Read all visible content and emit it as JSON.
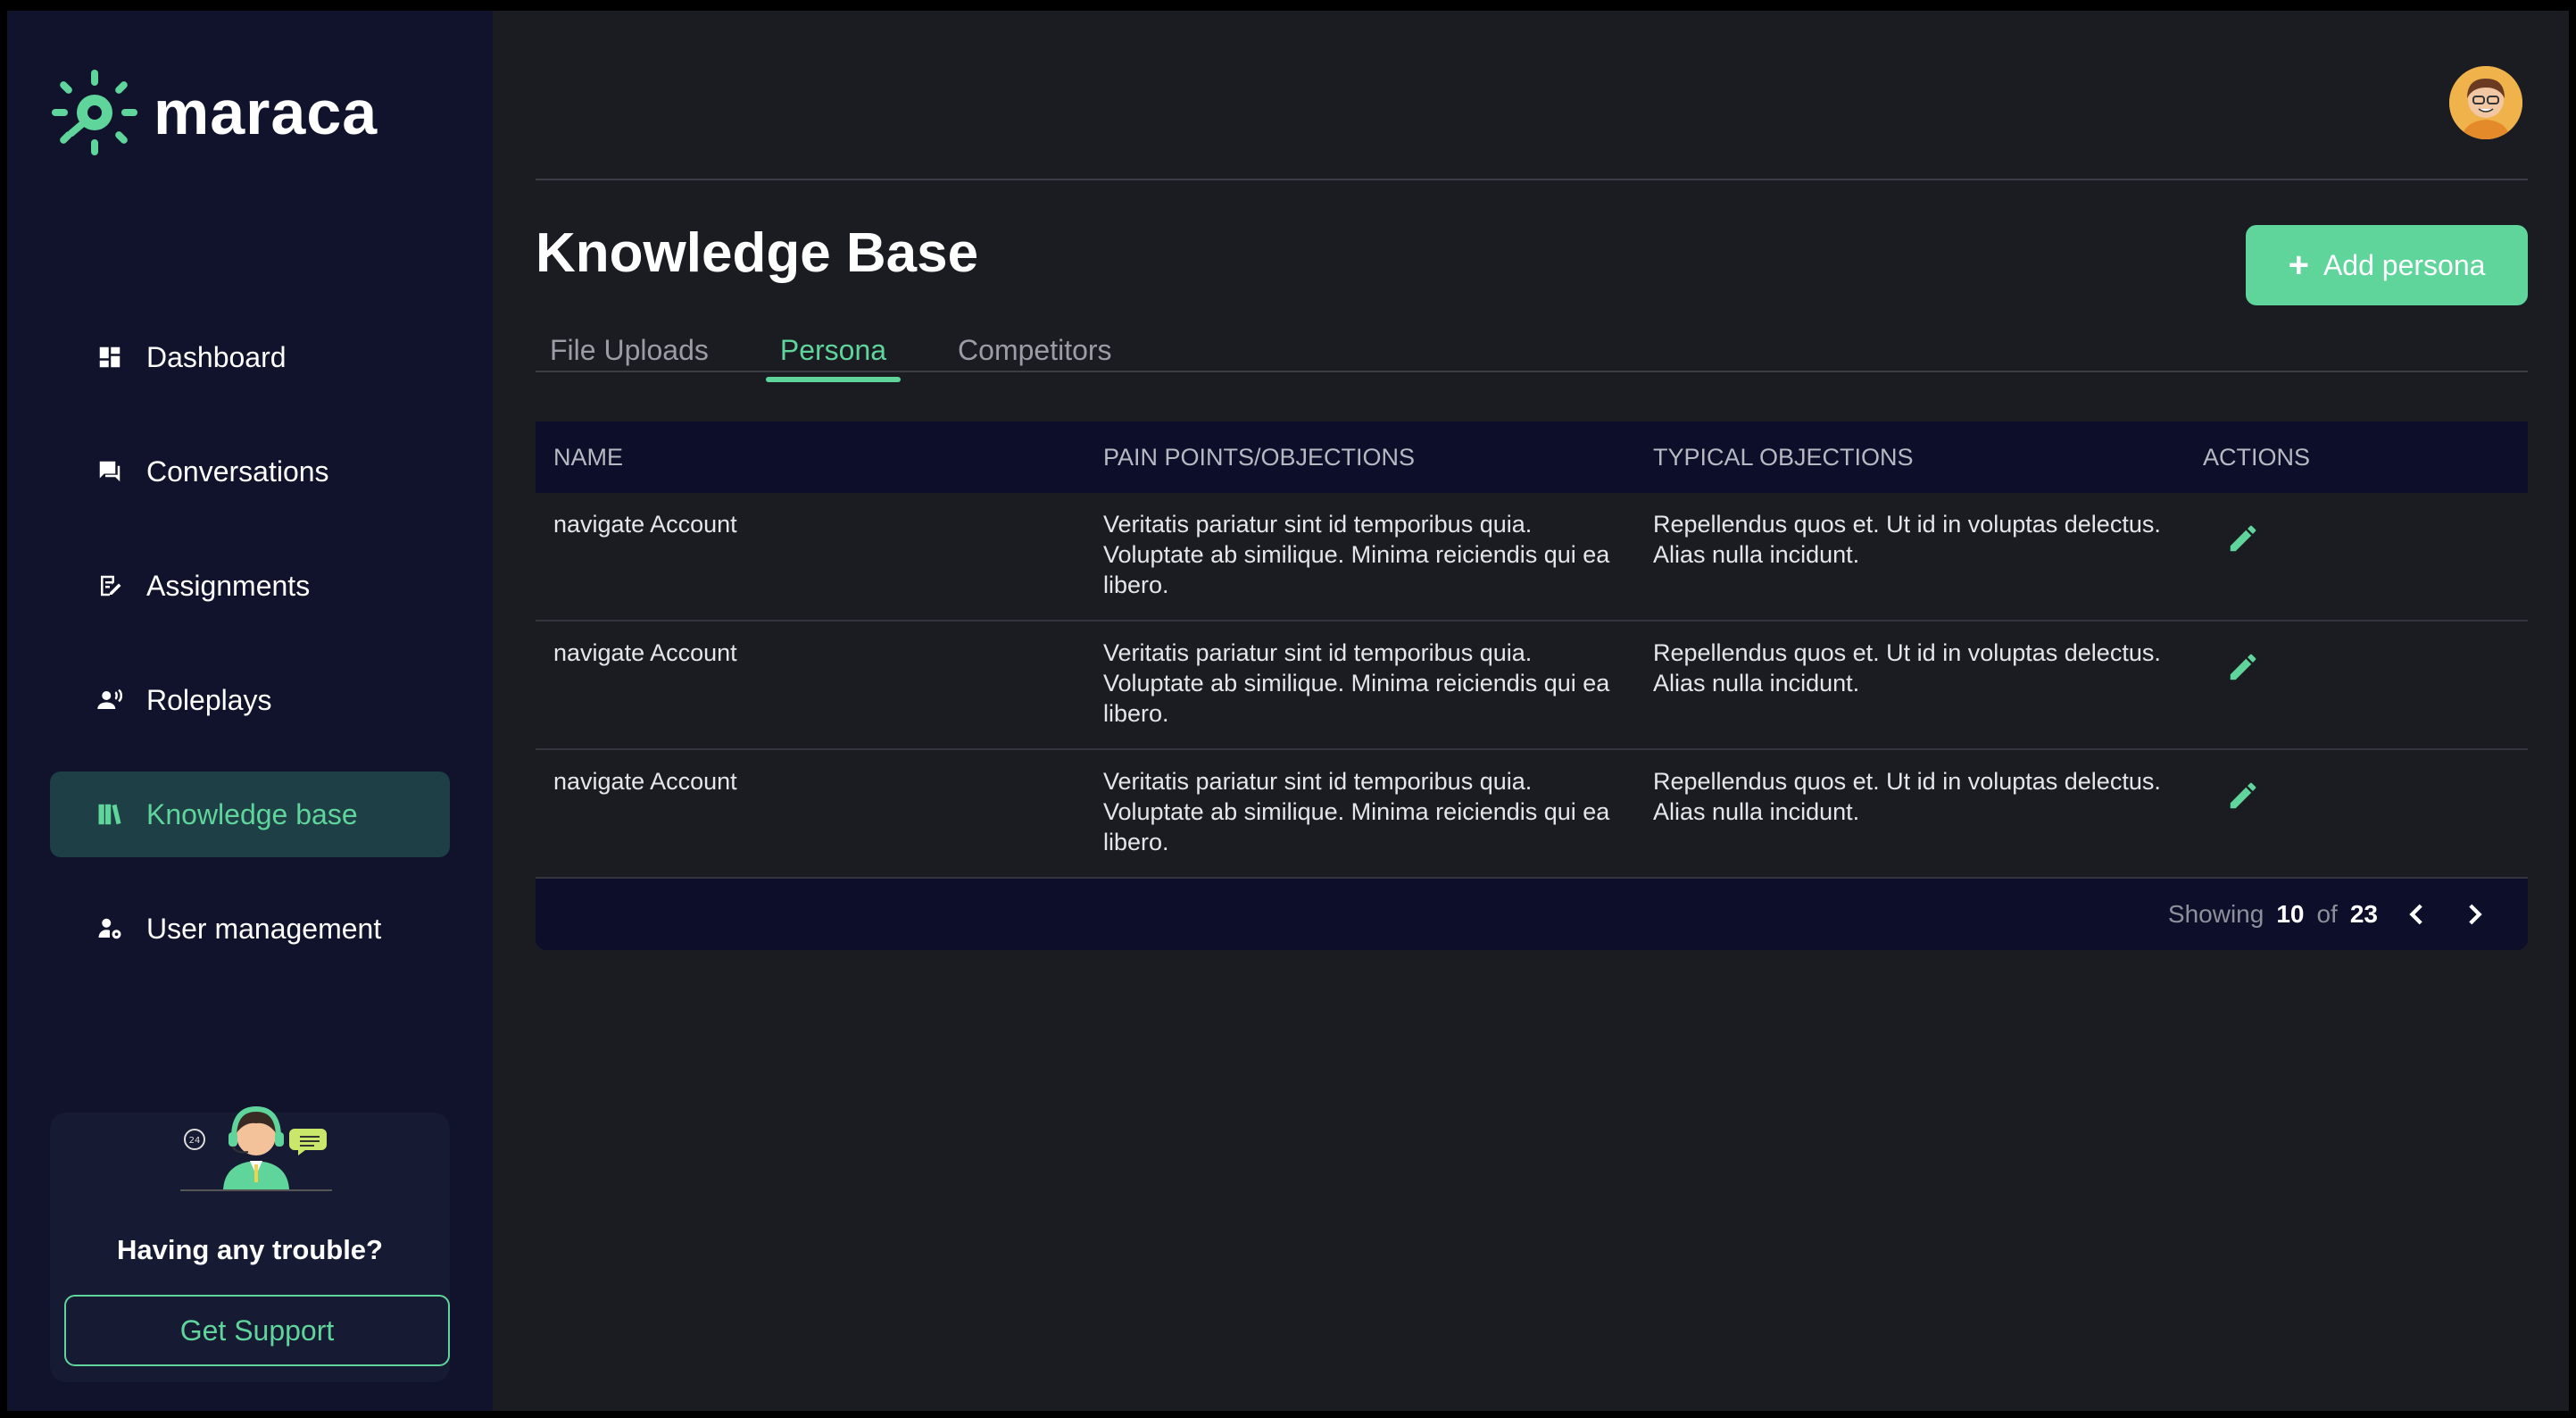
{
  "brand": {
    "name": "maraca",
    "accent": "#5fd49b"
  },
  "sidebar": {
    "items": [
      {
        "label": "Dashboard",
        "icon": "dashboard-icon"
      },
      {
        "label": "Conversations",
        "icon": "chat-icon"
      },
      {
        "label": "Assignments",
        "icon": "assignment-icon"
      },
      {
        "label": "Roleplays",
        "icon": "roleplay-icon"
      },
      {
        "label": "Knowledge base",
        "icon": "book-icon",
        "active": true
      },
      {
        "label": "User management",
        "icon": "user-settings-icon"
      }
    ],
    "support": {
      "title": "Having any trouble?",
      "button": "Get Support"
    }
  },
  "header": {
    "title": "Knowledge Base",
    "add_button": "Add persona"
  },
  "tabs": [
    {
      "label": "File Uploads"
    },
    {
      "label": "Persona",
      "active": true
    },
    {
      "label": "Competitors"
    }
  ],
  "table": {
    "columns": [
      "NAME",
      "PAIN POINTS/OBJECTIONS",
      "TYPICAL OBJECTIONS",
      "ACTIONS"
    ],
    "rows": [
      {
        "name": "navigate Account",
        "pain_points": "Veritatis pariatur sint id temporibus quia. Voluptate ab similique. Minima reiciendis qui ea libero.",
        "objections": "Repellendus quos et. Ut id in voluptas delectus. Alias nulla incidunt."
      },
      {
        "name": "navigate Account",
        "pain_points": "Veritatis pariatur sint id temporibus quia. Voluptate ab similique. Minima reiciendis qui ea libero.",
        "objections": "Repellendus quos et. Ut id in voluptas delectus. Alias nulla incidunt."
      },
      {
        "name": "navigate Account",
        "pain_points": "Veritatis pariatur sint id temporibus quia. Voluptate ab similique. Minima reiciendis qui ea libero.",
        "objections": "Repellendus quos et. Ut id in voluptas delectus. Alias nulla incidunt."
      }
    ],
    "footer": {
      "showing_label": "Showing",
      "showing_count": "10",
      "of_label": "of",
      "total": "23"
    }
  }
}
